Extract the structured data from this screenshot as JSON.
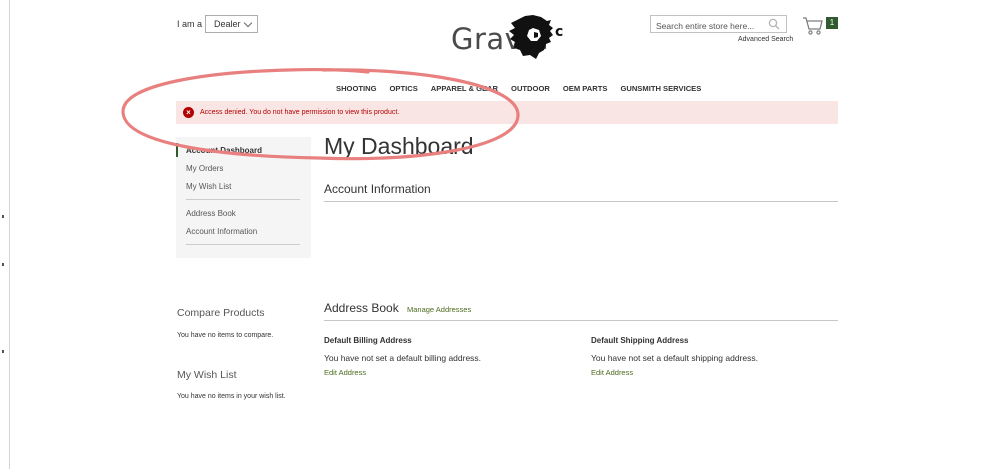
{
  "header": {
    "role_label": "I am a",
    "role_select_value": "Dealer",
    "logo_text": "Gravel",
    "search_placeholder": "Search entire store here...",
    "advanced_search": "Advanced Search",
    "cart_count": "1"
  },
  "nav": {
    "items": [
      "SHOOTING",
      "OPTICS",
      "APPAREL & GEAR",
      "OUTDOOR",
      "OEM PARTS",
      "GUNSMITH SERVICES"
    ]
  },
  "message": {
    "error_text": "Access denied. You do not have permission to view this product.",
    "icon_glyph": "×"
  },
  "sidebar": {
    "items": [
      "Account Dashboard",
      "My Orders",
      "My Wish List",
      "Address Book",
      "Account Information"
    ],
    "compare": {
      "title": "Compare Products",
      "empty": "You have no items to compare."
    },
    "wishlist": {
      "title": "My Wish List",
      "empty": "You have no items in your wish list."
    }
  },
  "main": {
    "page_title": "My Dashboard",
    "account_info_title": "Account Information",
    "address_book_title": "Address Book",
    "manage_addresses": "Manage Addresses",
    "billing": {
      "title": "Default Billing Address",
      "text": "You have not set a default billing address.",
      "edit": "Edit Address"
    },
    "shipping": {
      "title": "Default Shipping Address",
      "text": "You have not set a default shipping address.",
      "edit": "Edit Address"
    }
  },
  "colors": {
    "accent_green": "#2f5b2f",
    "link_green": "#4d6b1f",
    "error_red": "#b30000",
    "error_bg": "#fae5e5",
    "annotation_red": "#e8807f"
  },
  "icons": [
    "chevron-down-icon",
    "search-icon",
    "cart-icon",
    "error-icon",
    "lion-logo-icon"
  ]
}
